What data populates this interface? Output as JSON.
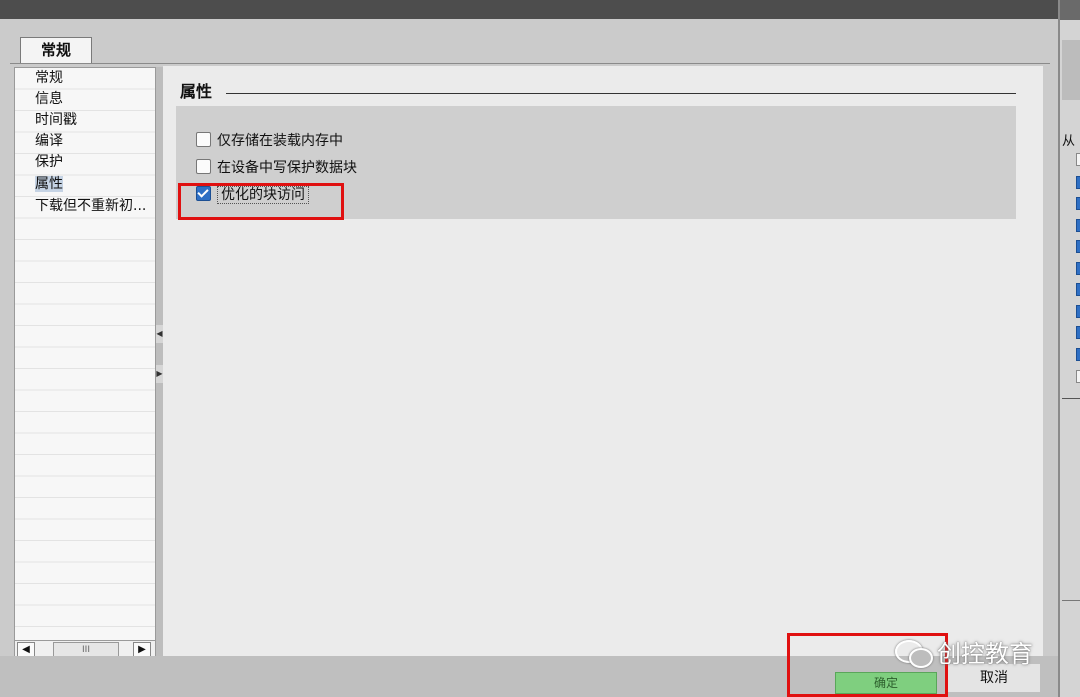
{
  "tabs": {
    "general": "常规"
  },
  "nav": {
    "items": [
      {
        "label": "常规"
      },
      {
        "label": "信息"
      },
      {
        "label": "时间戳"
      },
      {
        "label": "编译"
      },
      {
        "label": "保护"
      },
      {
        "label": "属性"
      },
      {
        "label": "下载但不重新初..."
      }
    ],
    "selected_index": 5,
    "scroll_thumb": "III"
  },
  "section": {
    "title": "属性",
    "options": [
      {
        "label": "仅存储在装载内存中",
        "checked": false
      },
      {
        "label": "在设备中写保护数据块",
        "checked": false
      },
      {
        "label": "优化的块访问",
        "checked": true
      }
    ]
  },
  "footer": {
    "ok_label": "确定",
    "cancel_label": "取消"
  },
  "watermark": {
    "text": "创控教育"
  },
  "right_panel": {
    "label": "从"
  },
  "colors": {
    "highlight": "#e01010",
    "checkbox_checked": "#2e6fc4",
    "ok_button": "#7fcf7f"
  }
}
